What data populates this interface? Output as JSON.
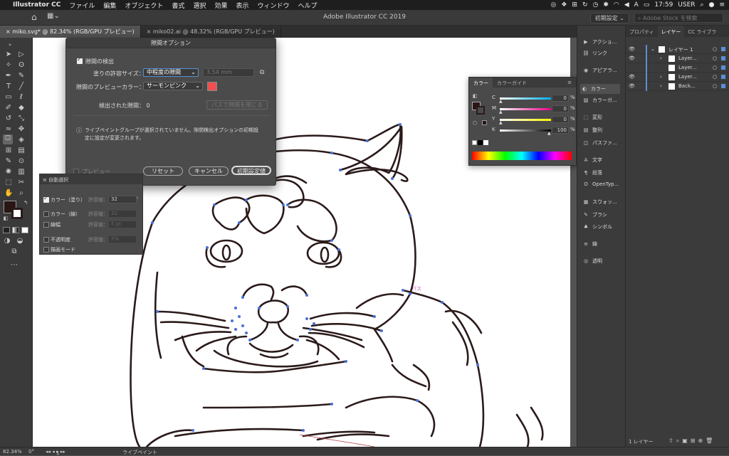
{
  "menubar": {
    "apple": "",
    "app_name": "Illustrator CC",
    "items": [
      "ファイル",
      "編集",
      "オブジェクト",
      "書式",
      "選択",
      "効果",
      "表示",
      "ウィンドウ",
      "ヘルプ"
    ],
    "status_icons": [
      "cc-icon",
      "dropbox-icon",
      "grid-icon",
      "history-icon",
      "time-machine-icon",
      "bluetooth-icon",
      "wifi-icon",
      "volume-icon",
      "input-method-icon",
      "battery-icon"
    ],
    "input_method": "A",
    "clock": "17:59",
    "user": "USER"
  },
  "appbar": {
    "title": "Adobe Illustrator CC 2019",
    "workspace": "初期設定",
    "stock_placeholder": "Adobe Stock を検索"
  },
  "tabs": [
    {
      "label": "miko.svg* @ 82.34% (RGB/GPU プレビュー)",
      "close": "×"
    },
    {
      "label": "miko02.ai @ 48.32% (RGB/GPU プレビュー)",
      "close": "×"
    }
  ],
  "gap_dialog": {
    "title": "隙間オプション",
    "detect_label": "隙間の検出",
    "fill_size_label": "塗りの許容サイズ：",
    "fill_size_value": "中程度の隙間",
    "custom_value": "3.54 mm",
    "preview_color_label": "隙間のプレビューカラー：",
    "preview_color_value": "サーモンピンク",
    "preview_color_hex": "#f05050",
    "found_label": "検出された隙間：",
    "found_count": "0",
    "close_paths_btn": "パスで隙間を閉じる",
    "info_icon": "ⓘ",
    "info_text_1": "ライブペイントグループが選択されていません。隙間検出オプションの初期設",
    "info_text_2": "定に設定が変更されます。",
    "preview_label": "プレビュー",
    "reset_btn": "リセット",
    "cancel_btn": "キャンセル",
    "ok_btn": "初期設定値"
  },
  "auto_select": {
    "title": "自動選択",
    "rows": [
      {
        "label": "カラー（塗り）",
        "tol_label": "許容値：",
        "value": "32",
        "checked": true
      },
      {
        "label": "カラー（線）",
        "tol_label": "許容値：",
        "value": "32",
        "checked": false
      },
      {
        "label": "線幅",
        "tol_label": "許容値：",
        "value": "5 pt",
        "checked": false
      },
      {
        "label": "不透明度",
        "tol_label": "許容値：",
        "value": "5%",
        "checked": false
      },
      {
        "label": "描画モード",
        "checked": false
      }
    ]
  },
  "color_panel": {
    "tabs": [
      "カラー",
      "カラーガイド"
    ],
    "sliders": [
      {
        "name": "C",
        "value": "0",
        "unit": "%",
        "level": 0
      },
      {
        "name": "M",
        "value": "0",
        "unit": "%",
        "level": 0
      },
      {
        "name": "Y",
        "value": "0",
        "unit": "%",
        "level": 0
      },
      {
        "name": "K",
        "value": "100",
        "unit": "%",
        "level": 1
      }
    ]
  },
  "dock": {
    "items": [
      "アクショ...",
      "リンク",
      "アピアラ...",
      "カラー",
      "カラーガ...",
      "変形",
      "整列",
      "パスファ...",
      "文字",
      "段落",
      "OpenTyp...",
      "スウォッ...",
      "ブラシ",
      "シンボル",
      "線",
      "透明"
    ]
  },
  "layers": {
    "tabs": [
      "プロパティ",
      "レイヤー",
      "CC ライブラ"
    ],
    "rows": [
      {
        "name": "レイヤー 1"
      },
      {
        "name": "Layer..."
      },
      {
        "name": "Layer..."
      },
      {
        "name": "Layer..."
      },
      {
        "name": "Back..."
      }
    ],
    "footer": "1 レイヤー"
  },
  "status": {
    "zoom": "82.34%",
    "rotation": "0°",
    "artboard": "1",
    "tool": "ライブペイント"
  },
  "canvas_annotation": "パス",
  "colors": {
    "accent": "#5a8fd6",
    "fill_swatch": "#2a1515",
    "stroke": "#2b1a1a"
  }
}
